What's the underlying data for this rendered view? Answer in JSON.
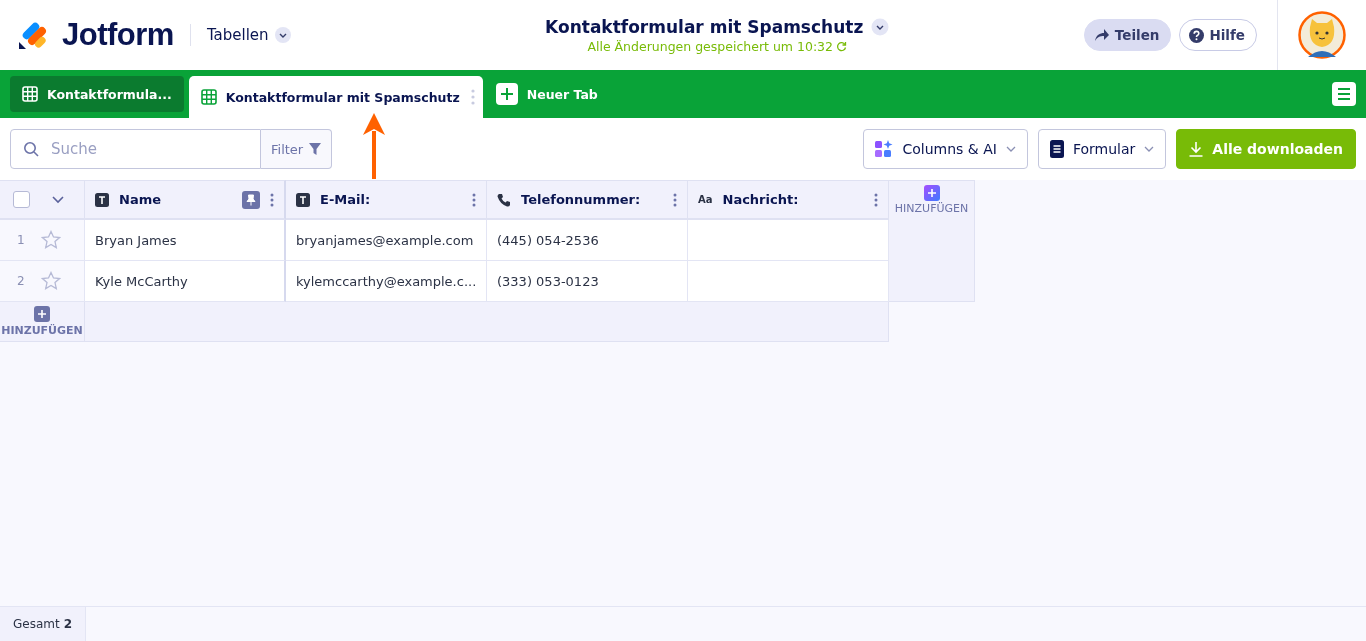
{
  "header": {
    "logo": "Jotform",
    "section": "Tabellen",
    "title": "Kontaktformular mit Spamschutz",
    "save_status": "Alle Änderungen gespeichert um 10:32",
    "buttons": [
      {
        "kind": "share",
        "label": "Teilen"
      },
      {
        "kind": "help",
        "label": "Hilfe"
      }
    ]
  },
  "tabs": [
    {
      "label": "Kontaktformula...",
      "selected": false
    },
    {
      "label": "Kontaktformular mit Spamschutz",
      "selected": true
    }
  ],
  "new_tab": "Neuer Tab",
  "toolbar": {
    "search": {
      "placeholder": "Suche"
    },
    "filter": "Filter",
    "buttons": [
      {
        "kind": "columns",
        "label": "Columns & AI"
      },
      {
        "kind": "form",
        "label": "Formular"
      },
      {
        "kind": "download",
        "label": "Alle downloaden"
      }
    ]
  },
  "table": {
    "columns": [
      {
        "kind": "text",
        "label": "Name",
        "pinned": true
      },
      {
        "kind": "text",
        "label": "E-Mail:",
        "pinned": false
      },
      {
        "kind": "phone",
        "label": "Telefonnummer:",
        "pinned": false
      },
      {
        "kind": "longtext",
        "icon_text": "Aa",
        "label": "Nachricht:",
        "pinned": false
      }
    ],
    "select_all_checked": false,
    "add_column": "HINZUFÜGEN",
    "rows": [
      {
        "number": "1",
        "starred": false,
        "cells": [
          "Bryan James",
          "bryanjames@example.com",
          "(445) 054-2536",
          ""
        ]
      },
      {
        "number": "2",
        "starred": false,
        "cells": [
          "Kyle McCarthy",
          "kylemccarthy@example.c...",
          "(333) 053-0123",
          ""
        ]
      }
    ],
    "add_row": "HINZUFÜGEN"
  },
  "status_bar": {
    "total_label": "Gesamt",
    "total_count": "2"
  }
}
